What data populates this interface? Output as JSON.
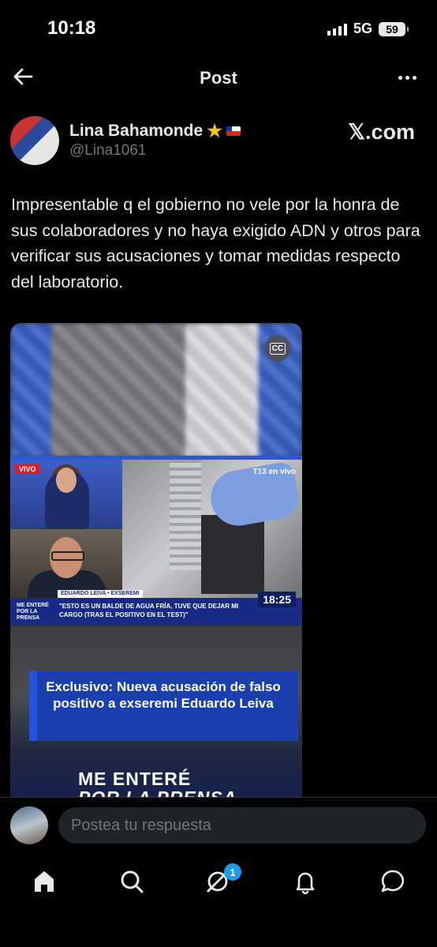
{
  "status_bar": {
    "time": "10:18",
    "network": "5G",
    "battery": "59"
  },
  "header": {
    "title": "Post"
  },
  "author": {
    "name": "Lina Bahamonde",
    "handle": "@Lina1061",
    "source": "𝕏.com"
  },
  "post": {
    "text": "Impresentable q el gobierno no vele por la honra de sus colaboradores y no haya exigido ADN y otros para verificar sus acusaciones y tomar medidas respecto del laboratorio."
  },
  "media": {
    "cc_label": "CC",
    "live_badge": "VIVO",
    "channel": "T13 en vivo",
    "guest_label": "EDUARDO LEIVA • EXSEREMI",
    "show_logo": "ME ENTERÉ POR LA PRENSA",
    "quote": "\"ESTO ES UN BALDE DE AGUA FRÍA, TUVE QUE DEJAR MI CARGO (TRAS EL POSITIVO EN EL TEST)\"",
    "clock": "18:25",
    "headline": "Exclusivo: Nueva acusación de falso positivo a exseremi Eduardo Leiva",
    "footer_logo_1": "ME ENTERÉ",
    "footer_logo_2": "POR LA PRENSA"
  },
  "reply": {
    "placeholder": "Postea tu respuesta"
  },
  "nav": {
    "badge_count": "1"
  }
}
